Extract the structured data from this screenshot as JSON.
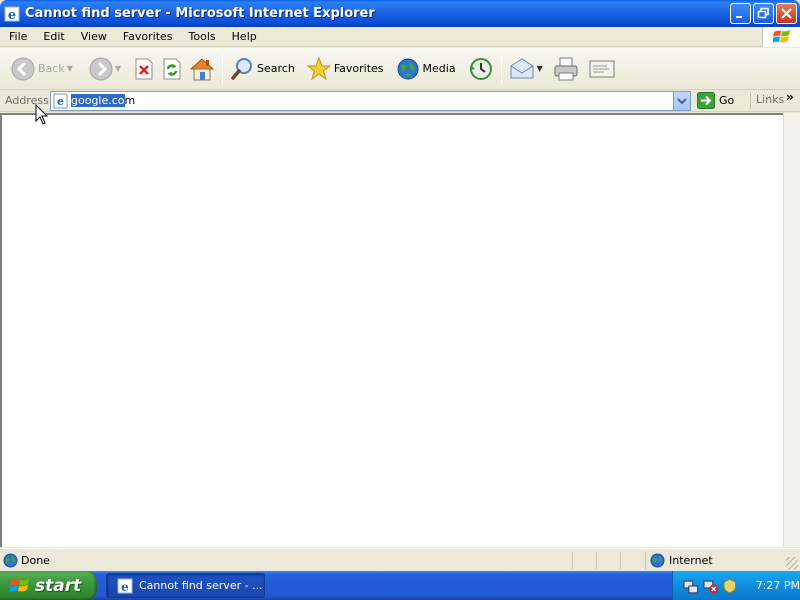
{
  "window": {
    "title": "Cannot find server - Microsoft Internet Explorer"
  },
  "menu": {
    "items": [
      "File",
      "Edit",
      "View",
      "Favorites",
      "Tools",
      "Help"
    ]
  },
  "toolbar": {
    "back_label": "Back",
    "search_label": "Search",
    "favorites_label": "Favorites",
    "media_label": "Media"
  },
  "address_bar": {
    "label": "Address",
    "url_selected": "google.co",
    "url_rest": "m",
    "go_label": "Go",
    "links_label": "Links"
  },
  "status_bar": {
    "status_text": "Done",
    "zone_text": "Internet"
  },
  "taskbar": {
    "start_label": "start",
    "task_label": "Cannot find server - ...",
    "clock": "7:27 PM"
  },
  "colors": {
    "title_bar": "#0A4CD6",
    "selection": "#316AC5",
    "start_button": "#3C9A3C",
    "tray": "#0F8DE0"
  }
}
